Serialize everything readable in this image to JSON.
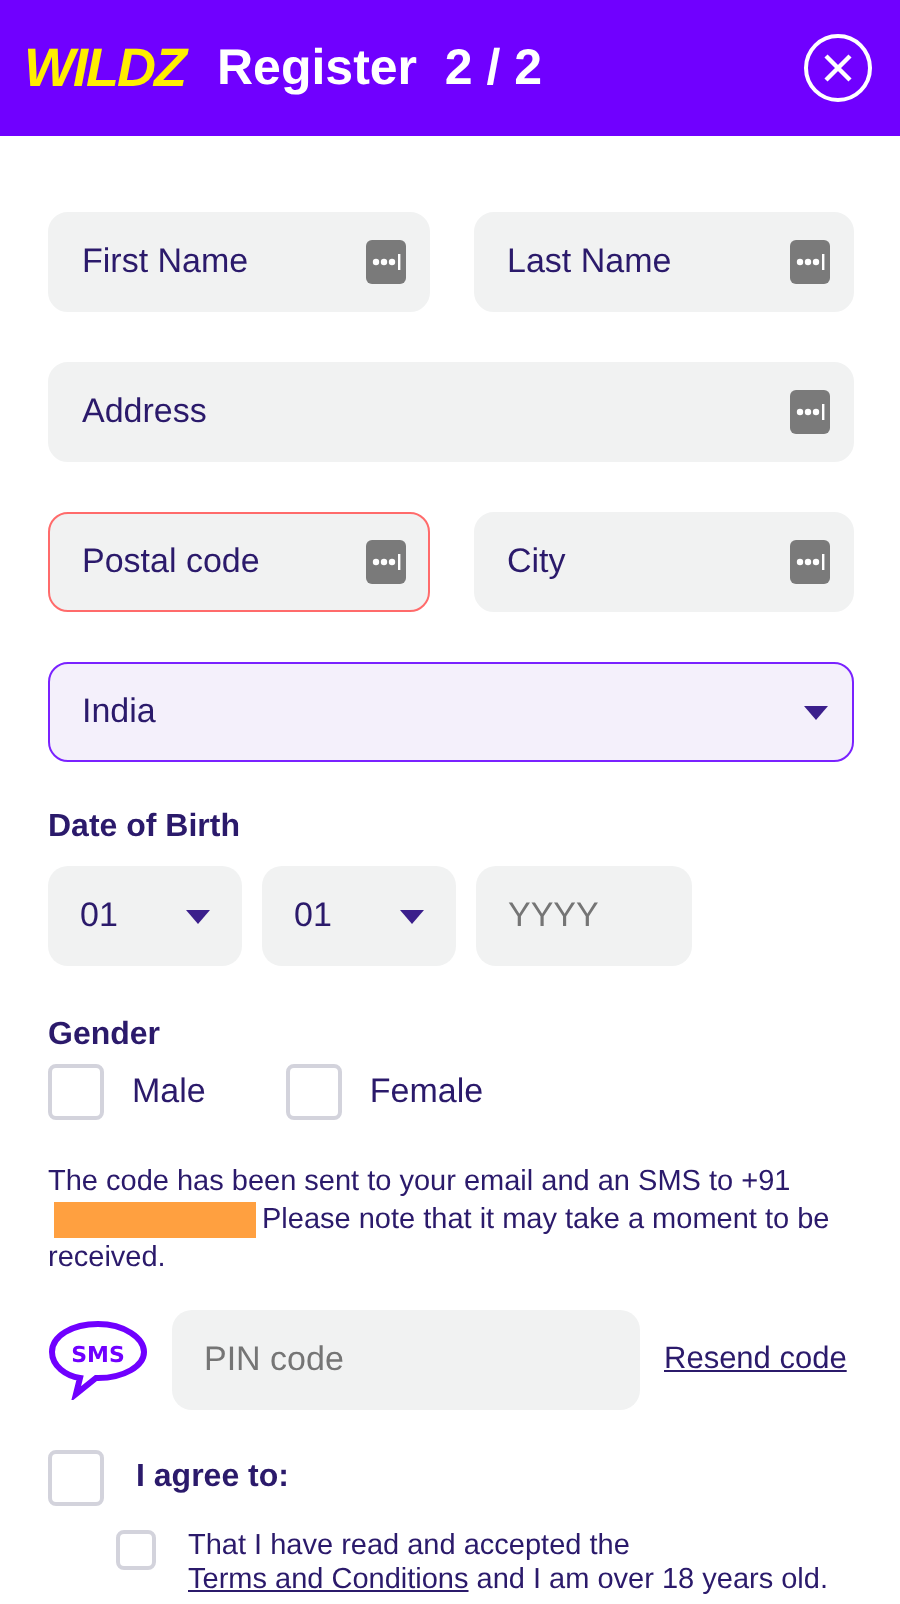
{
  "header": {
    "logo": "WILDZ",
    "title": "Register  2 / 2"
  },
  "fields": [
    {
      "kind": "text",
      "placeholder": "First Name",
      "error": false,
      "focused": false
    },
    {
      "kind": "text",
      "placeholder": "Last Name",
      "error": false,
      "focused": false
    },
    {
      "kind": "text",
      "placeholder": "Address",
      "error": false,
      "focused": false
    },
    {
      "kind": "text",
      "placeholder": "Postal code",
      "error": true,
      "focused": false
    },
    {
      "kind": "text",
      "placeholder": "City",
      "error": false,
      "focused": false
    },
    {
      "kind": "select",
      "value": "India",
      "error": false,
      "focused": true
    }
  ],
  "date_of_birth": {
    "label": "Date of Birth",
    "parts": [
      {
        "kind": "select",
        "value": "01"
      },
      {
        "kind": "select",
        "value": "01"
      },
      {
        "kind": "text",
        "placeholder": "YYYY"
      }
    ]
  },
  "gender": {
    "label": "Gender",
    "options": [
      {
        "label": "Male",
        "selected": false
      },
      {
        "label": "Female",
        "selected": false
      }
    ]
  },
  "notice": {
    "before": "The code has been sent to your email and an SMS to +91",
    "redacted": true,
    "after": "Please note that it may take a moment to be received."
  },
  "pin": {
    "icon_text": "SMS",
    "placeholder": "PIN code",
    "resend": "Resend code"
  },
  "agree": {
    "label": "I agree to:",
    "checked": false
  },
  "terms": {
    "checked": false,
    "before": "That I have read and accepted the",
    "link": "Terms and Conditions",
    "after": "and I am over 18 years old."
  }
}
